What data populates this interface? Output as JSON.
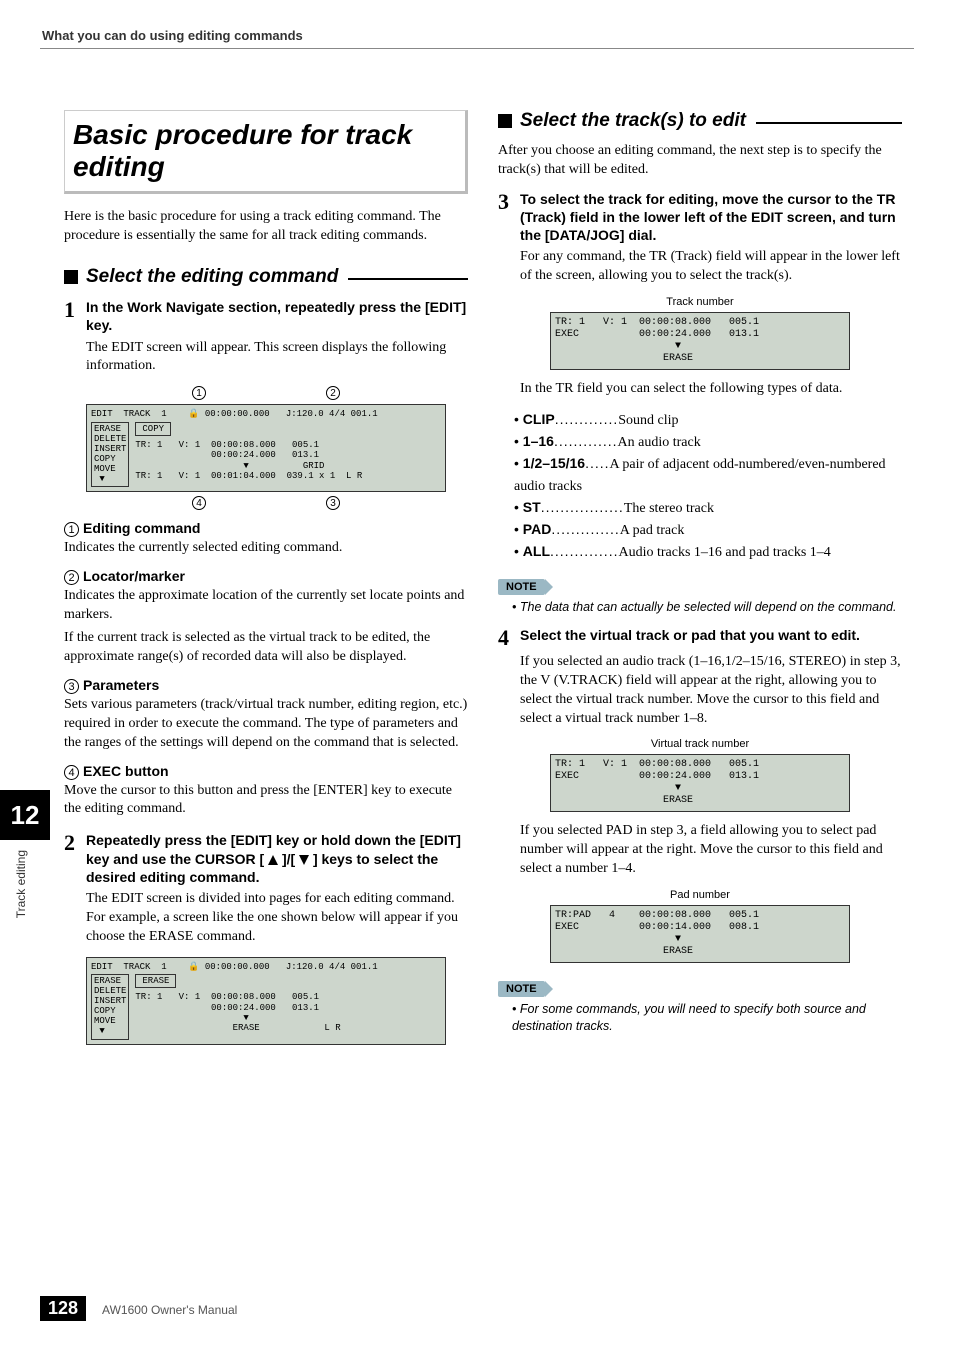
{
  "header": {
    "title": "What you can do using editing commands"
  },
  "sidebar": {
    "chapter_number": "12",
    "chapter_label": "Track editing"
  },
  "left": {
    "title": "Basic procedure for track editing",
    "intro": "Here is the basic procedure for using a track editing command. The procedure is essentially the same for all track editing commands.",
    "subhead1": "Select the editing command",
    "step1_title": "In the Work Navigate section, repeatedly press the [EDIT] key.",
    "step1_body": "The EDIT screen will appear. This screen displays the following information.",
    "fig1": {
      "title_bar": "EDIT  TRACK  1    🔒 00:00:00.000   J:120.0 4/4 001.1",
      "menu": "ERASE\nDELETE\nINSERT\nCOPY\nMOVE\n ▼",
      "mid": "COPY",
      "params": "TR: 1   V: 1  00:00:08.000   005.1\n              00:00:24.000   013.1\n                    ▼          GRID\nTR: 1   V: 1  00:01:04.000  039.1 x 1  L R"
    },
    "l1_label": "Editing command",
    "l1_body": "Indicates the currently selected editing command.",
    "l2_label": "Locator/marker",
    "l2_body1": "Indicates the approximate location of the currently set locate points and markers.",
    "l2_body2": "If the current track is selected as the virtual track to be edited, the approximate range(s) of recorded data will also be displayed.",
    "l3_label": "Parameters",
    "l3_body": "Sets various parameters (track/virtual track number, editing region, etc.) required in order to execute the command. The type of parameters and the ranges of the settings will depend on the command that is selected.",
    "l4_label": "EXEC button",
    "l4_body": "Move the cursor to this button and press the [ENTER] key to execute the editing command.",
    "step2_title_a": "Repeatedly press the [EDIT] key or hold down the [EDIT] key and use the CURSOR [",
    "step2_title_b": "]/[",
    "step2_title_c": "] keys to select the desired editing command.",
    "step2_body": "The EDIT screen is divided into pages for each editing command. For example, a screen like the one shown below will appear if you choose the ERASE command.",
    "fig2": {
      "title_bar": "EDIT  TRACK  1    🔒 00:00:00.000   J:120.0 4/4 001.1",
      "menu": "ERASE\nDELETE\nINSERT\nCOPY\nMOVE\n ▼",
      "mid": "ERASE",
      "params": "TR: 1   V: 1  00:00:08.000   005.1\n              00:00:24.000   013.1\n                    ▼\n                  ERASE            L R"
    }
  },
  "right": {
    "subhead2": "Select the track(s) to edit",
    "intro2": "After you choose an editing command, the next step is to specify the track(s) that will be edited.",
    "step3_title": "To select the track for editing, move the cursor to the TR (Track) field in the lower left of the EDIT screen, and turn the [DATA/JOG] dial.",
    "step3_body": "For any command, the TR (Track) field will appear in the lower left of the screen, allowing you to select the track(s).",
    "fig3_caption": "Track number",
    "fig3": "TR: 1   V: 1  00:00:08.000   005.1\nEXEC          00:00:24.000   013.1\n                    ▼\n                  ERASE",
    "after_fig3": "In the TR field you can select the following types of data.",
    "bullets": [
      {
        "term": "CLIP",
        "dots": ".............",
        "desc": "Sound clip"
      },
      {
        "term": "1–16",
        "dots": ".............",
        "desc": "An audio track"
      },
      {
        "term": "1/2–15/16",
        "dots": ".....",
        "desc": "A pair of adjacent odd-numbered/even-numbered audio tracks"
      },
      {
        "term": "ST",
        "dots": ".................",
        "desc": "The stereo track"
      },
      {
        "term": "PAD",
        "dots": "..............",
        "desc": "A pad track"
      },
      {
        "term": "ALL",
        "dots": "..............",
        "desc": "Audio tracks 1–16 and pad tracks 1–4"
      }
    ],
    "note1_label": "NOTE",
    "note1": "The data that can actually be selected will depend on the command.",
    "step4_title": "Select the virtual track or pad that you want to edit.",
    "step4_body": "If you selected an audio track (1–16,1/2–15/16, STEREO) in step 3, the V (V.TRACK) field will appear at the right, allowing you to select the virtual track number. Move the cursor to this field and select a virtual track number 1–8.",
    "fig4_caption": "Virtual track number",
    "fig4": "TR: 1   V: 1  00:00:08.000   005.1\nEXEC          00:00:24.000   013.1\n                    ▼\n                  ERASE",
    "after_fig4": "If you selected PAD in step 3, a field allowing you to select pad number will appear at the right. Move the cursor to this field and select a number 1–4.",
    "fig5_caption": "Pad number",
    "fig5": "TR:PAD   4    00:00:08.000   005.1\nEXEC          00:00:14.000   008.1\n                    ▼\n                  ERASE",
    "note2_label": "NOTE",
    "note2": "For some commands, you will need to specify both source and destination tracks."
  },
  "footer": {
    "page": "128",
    "manual": "AW1600  Owner's Manual"
  }
}
